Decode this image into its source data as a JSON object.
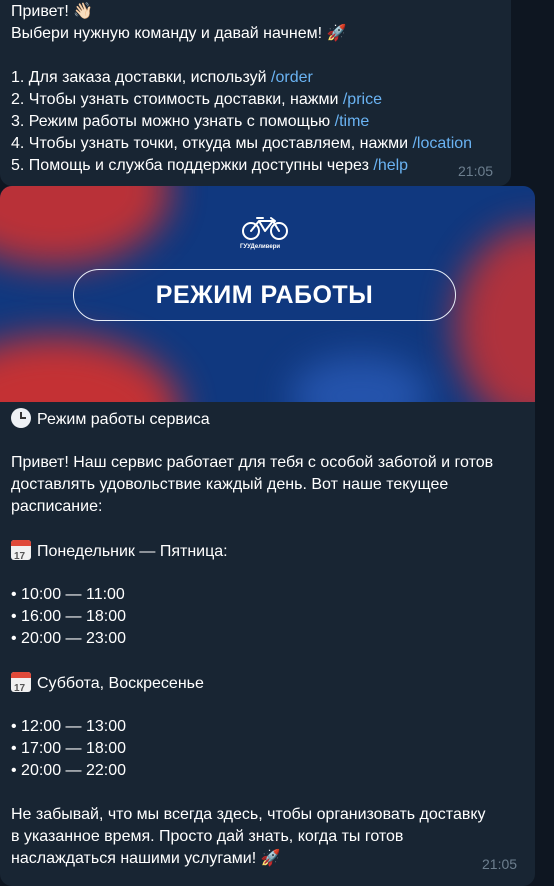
{
  "message1": {
    "greeting": "Привет! 👋🏻",
    "intro": "Выбери нужную команду и давай начнем! 🚀",
    "items": [
      {
        "text": "1. Для заказа доставки, используй ",
        "command": "/order"
      },
      {
        "text": "2. Чтобы узнать стоимость доставки, нажми ",
        "command": "/price"
      },
      {
        "text": "3. Режим работы можно узнать с помощью ",
        "command": "/time"
      },
      {
        "text": "4. Чтобы узнать точки, откуда мы доставляем, нажми ",
        "command": "/location"
      },
      {
        "text": "5. Помощь и служба поддержки доступны через ",
        "command": "/help"
      }
    ],
    "time": "21:05"
  },
  "message2": {
    "banner": {
      "brand": "ГУУДеливери",
      "title": "РЕЖИМ РАБОТЫ",
      "icon": "bicycle-icon"
    },
    "heading": "Режим работы сервиса",
    "heading_icon": "clock-icon",
    "paragraph": [
      "Привет! Наш сервис работает для тебя с особой заботой и готов",
      "доставлять удовольствие каждый день. Вот наше текущее",
      "расписание:"
    ],
    "weekdays_title": "Понедельник — Пятница:",
    "weekdays_icon": "calendar-icon",
    "weekdays": [
      "• 10:00 — 11:00",
      "• 16:00 — 18:00",
      "• 20:00 — 23:00"
    ],
    "weekend_title": "Суббота, Воскресенье",
    "weekend_icon": "calendar-icon",
    "weekend": [
      "• 12:00 — 13:00",
      "• 17:00 — 18:00",
      "• 20:00 — 22:00"
    ],
    "closing": [
      "Не забывай, что мы всегда здесь, чтобы организовать доставку",
      "в указанное время. Просто дай знать, когда ты готов",
      "наслаждаться нашими услугами! 🚀"
    ],
    "time": "21:05"
  },
  "colors": {
    "background": "#0e1621",
    "bubble": "#182533",
    "link": "#6ab3f3",
    "banner_blue": "#10387f",
    "banner_red": "#d8312c"
  }
}
